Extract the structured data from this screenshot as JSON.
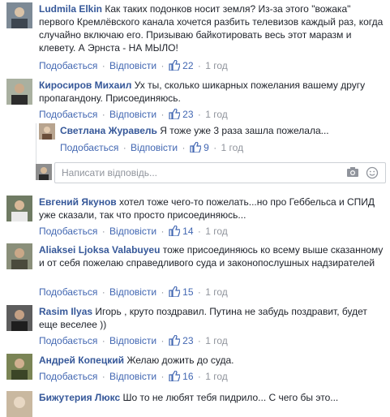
{
  "actions": {
    "like": "Подобається",
    "reply": "Відповісти",
    "sep": "·"
  },
  "comments": [
    {
      "author": "Ludmila Elkin",
      "text": "Как таких подонков носит земля? Из-за этого \"вожака\" первого Кремлёвского канала хочется разбить телевизов каждый раз, когда случайно включаю его. Призываю байкотировать весь этот маразм и клевету. А Эрнста - НА МЫЛО!",
      "likes": "22",
      "time": "1 год"
    },
    {
      "author": "Киросиров Михаил",
      "text": "Ух ты, сколько шикарных пожелания вашему другу пропагандону. Присоединяюсь.",
      "likes": "23",
      "time": "1 год"
    },
    {
      "author": "Евгений Якунов",
      "text": "хотел тоже чего-то пожелать...но про Геббельса и СПИД уже сказали, так что просто присоединяюсь...",
      "likes": "14",
      "time": "1 год"
    },
    {
      "author": "Aliaksei Ljoksa Valabuyeu",
      "text": "тоже присоединяюсь ко всему выше сказанному и от себя пожелаю справедливого суда и законопослушных надзирателей",
      "likes": "15",
      "time": "1 год"
    },
    {
      "author": "Rasim Ilyas",
      "text": "Игорь , круто поздравил. Путина не забудь поздравит, будет еще веселее ))",
      "likes": "23",
      "time": "1 год"
    },
    {
      "author": "Андрей Копецкий",
      "text": "Желаю дожить до суда.",
      "likes": "16",
      "time": "1 год"
    },
    {
      "author": "Бижутерия Люкс",
      "text": "Шо то не любят тебя пидрило... С чего бы это..."
    }
  ],
  "reply": {
    "author": "Светлана Журавель",
    "text": "Я тоже уже 3 раза зашла пожелала...",
    "likes": "9",
    "time": "1 год"
  },
  "reply_box": {
    "placeholder": "Написати відповідь..."
  },
  "colors": {
    "link": "#365899",
    "action": "#4267b2",
    "meta": "#90949c"
  }
}
